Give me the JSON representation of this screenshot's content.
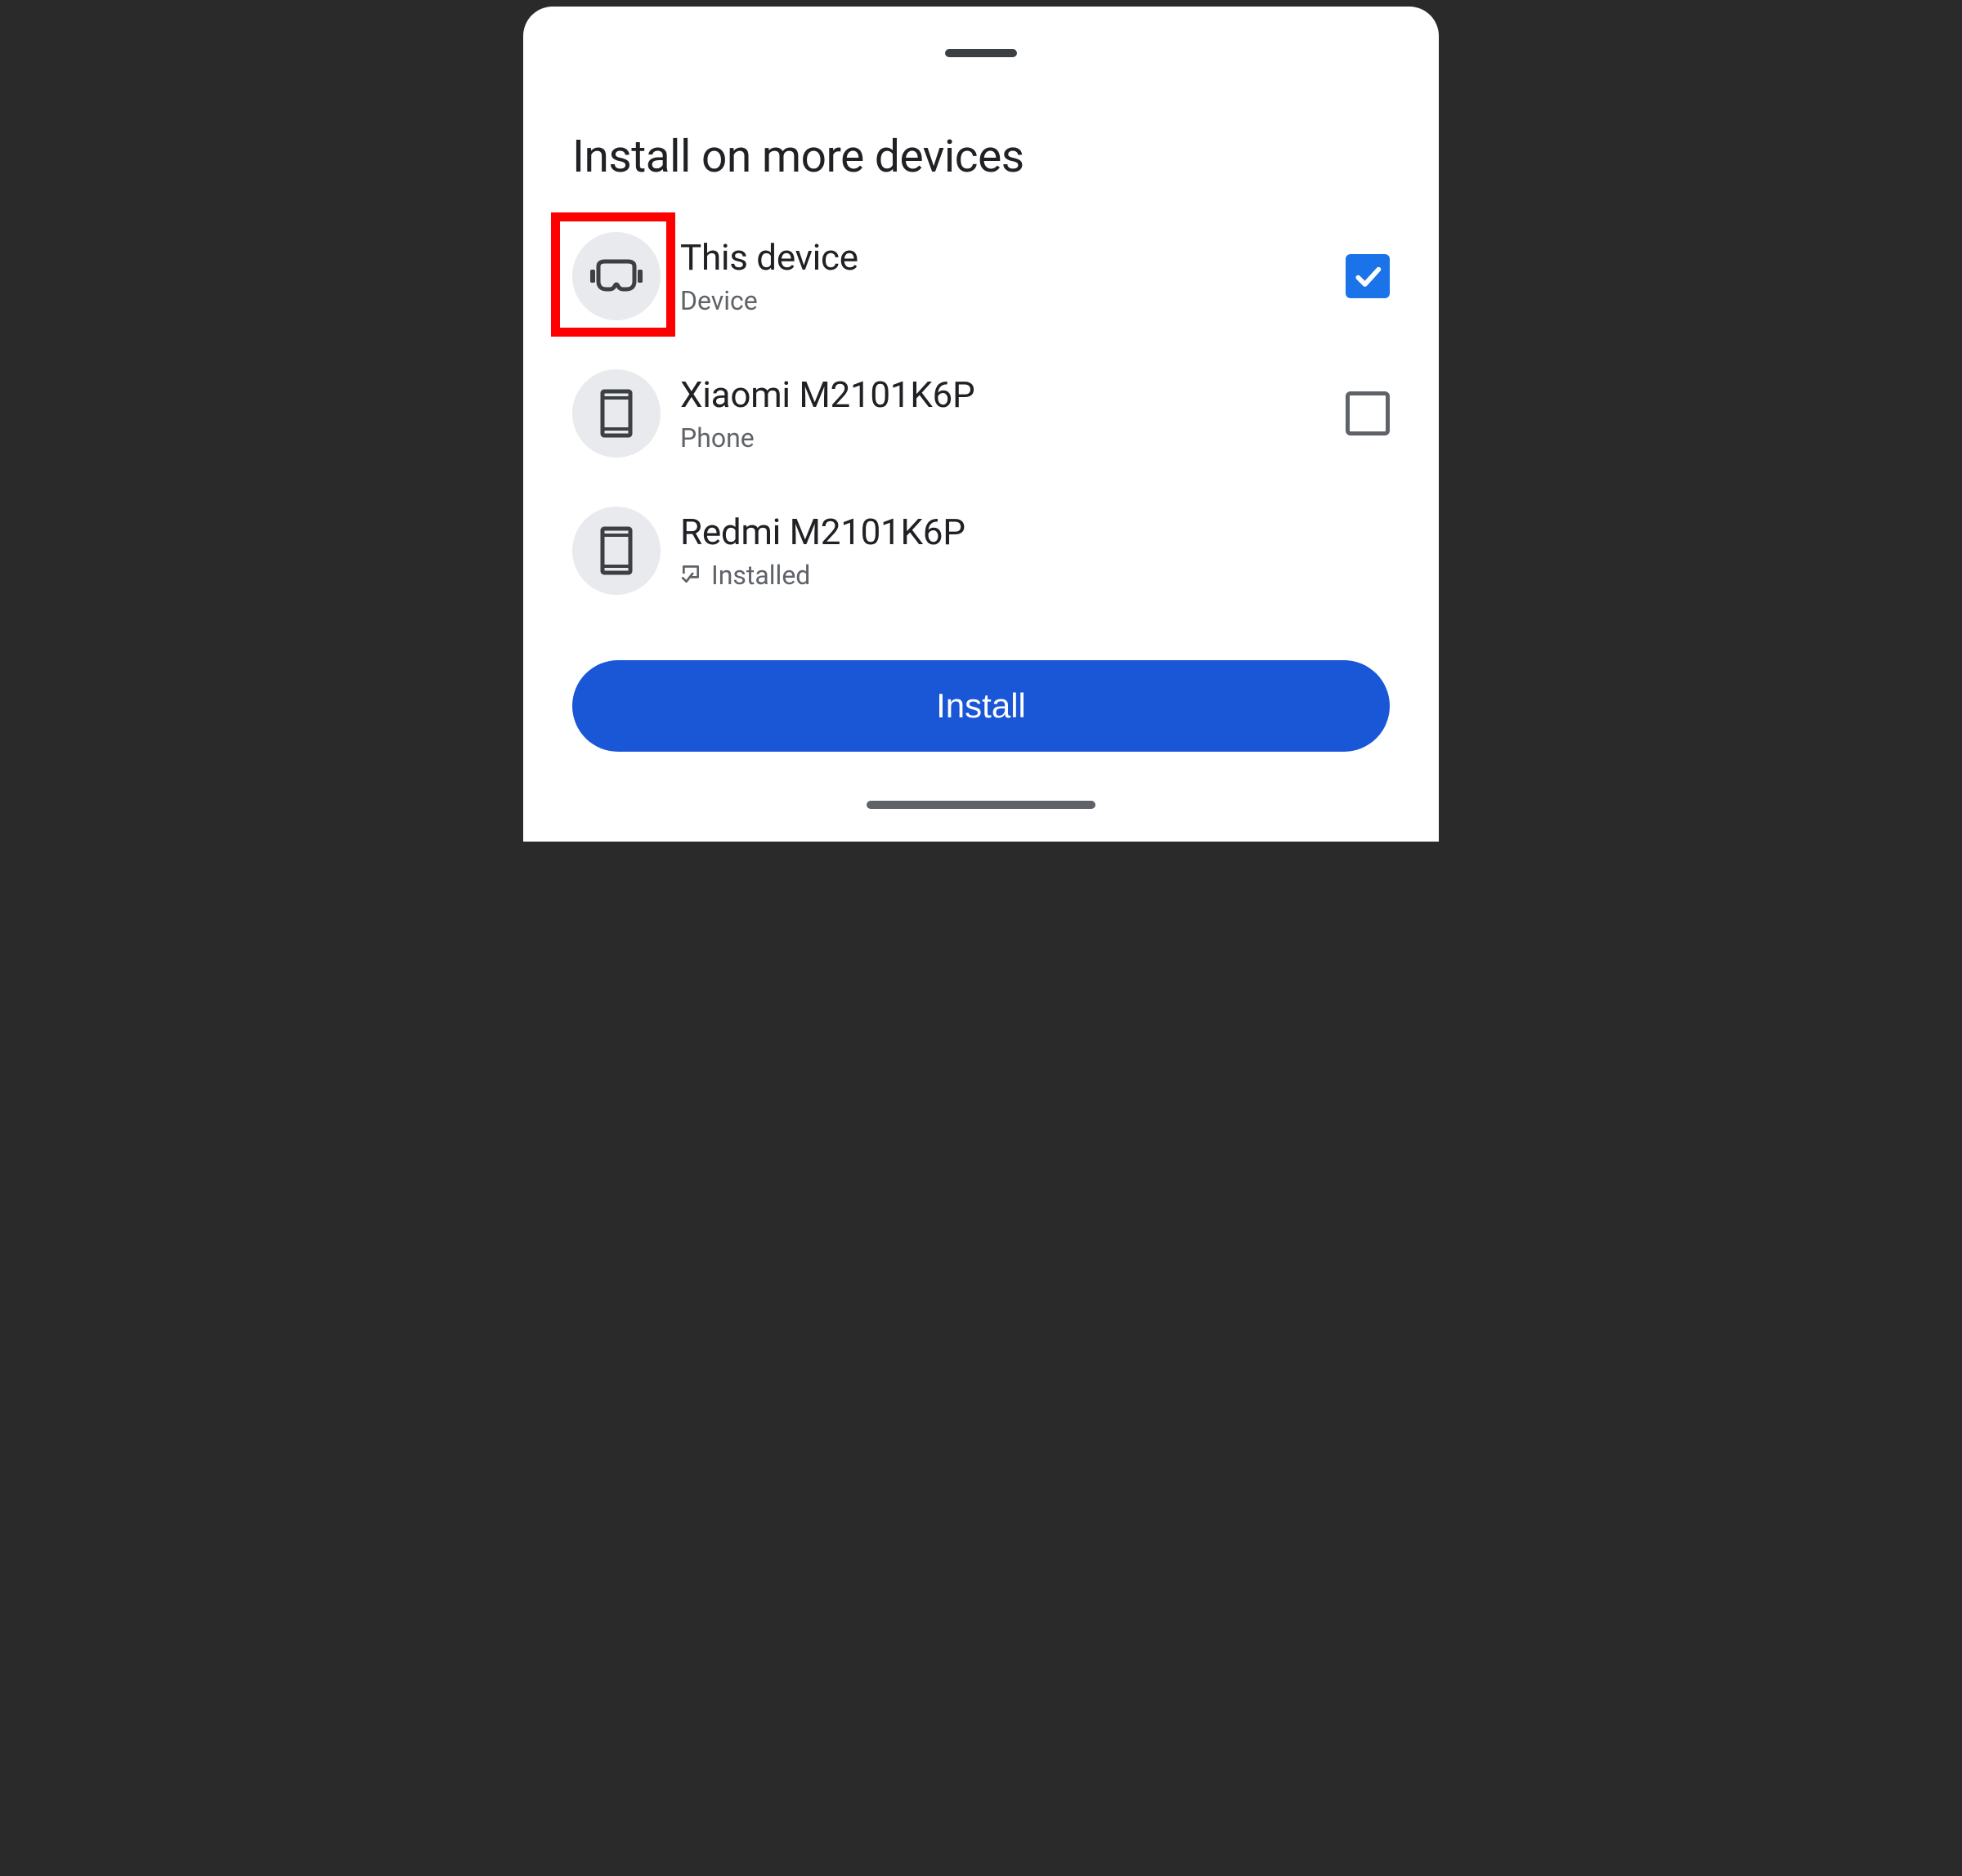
{
  "title": "Install on more devices",
  "devices": [
    {
      "name": "This device",
      "subtitle": "Device",
      "icon": "headset",
      "checked": true,
      "highlighted": true,
      "installed": false
    },
    {
      "name": "Xiaomi M2101K6P",
      "subtitle": "Phone",
      "icon": "phone",
      "checked": false,
      "highlighted": false,
      "installed": false
    },
    {
      "name": "Redmi M2101K6P",
      "subtitle": "Installed",
      "icon": "phone",
      "checked": null,
      "highlighted": false,
      "installed": true
    }
  ],
  "button_label": "Install",
  "colors": {
    "primary": "#1a57d6",
    "checkbox": "#1a73e8",
    "highlight": "#ff0000"
  }
}
